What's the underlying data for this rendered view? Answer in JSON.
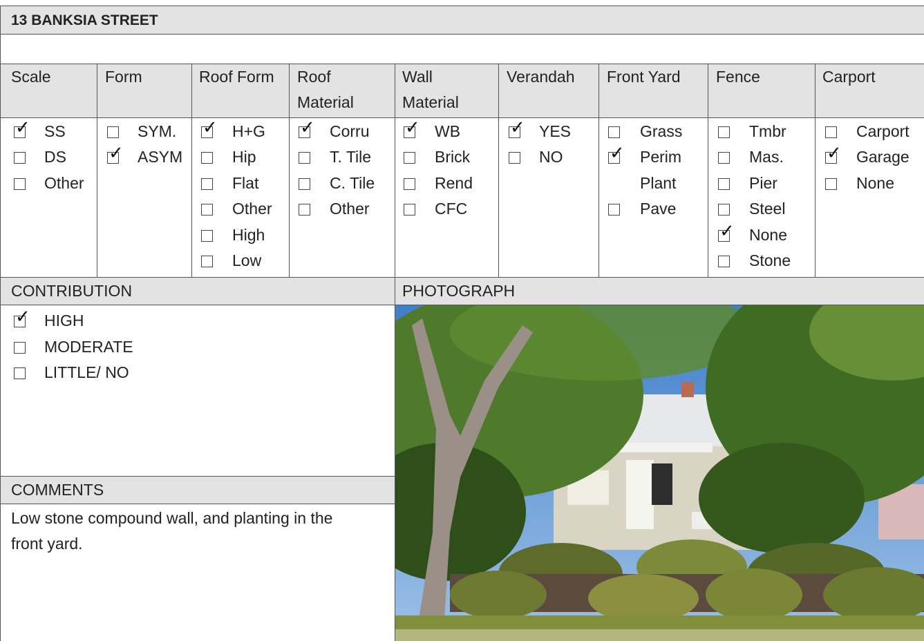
{
  "title": "13 BANKSIA STREET",
  "columns": [
    {
      "header": "Scale",
      "options": [
        {
          "label": "SS",
          "checked": true
        },
        {
          "label": "DS",
          "checked": false
        },
        {
          "label": "Other",
          "checked": false
        }
      ]
    },
    {
      "header": "Form",
      "options": [
        {
          "label": "SYM.",
          "checked": false
        },
        {
          "label": "ASYM",
          "checked": true
        }
      ]
    },
    {
      "header": "Roof Form",
      "options": [
        {
          "label": "H+G",
          "checked": true
        },
        {
          "label": "Hip",
          "checked": false
        },
        {
          "label": "Flat",
          "checked": false
        },
        {
          "label": "Other",
          "checked": false
        },
        {
          "label": "High",
          "checked": false
        },
        {
          "label": "Low",
          "checked": false
        }
      ]
    },
    {
      "header": "Roof\nMaterial",
      "options": [
        {
          "label": "Corru",
          "checked": true
        },
        {
          "label": "T. Tile",
          "checked": false
        },
        {
          "label": "C. Tile",
          "checked": false
        },
        {
          "label": "Other",
          "checked": false
        }
      ]
    },
    {
      "header": "Wall\nMaterial",
      "options": [
        {
          "label": "WB",
          "checked": true
        },
        {
          "label": "Brick",
          "checked": false
        },
        {
          "label": "Rend",
          "checked": false
        },
        {
          "label": "CFC",
          "checked": false
        }
      ]
    },
    {
      "header": "Verandah",
      "options": [
        {
          "label": "YES",
          "checked": true
        },
        {
          "label": "NO",
          "checked": false
        }
      ]
    },
    {
      "header": "Front Yard",
      "options": [
        {
          "label": "Grass",
          "checked": false
        },
        {
          "label": "Perim\nPlant",
          "checked": true
        },
        {
          "label": "Pave",
          "checked": false
        }
      ]
    },
    {
      "header": "Fence",
      "options": [
        {
          "label": "Tmbr",
          "checked": false
        },
        {
          "label": "Mas.",
          "checked": false
        },
        {
          "label": "Pier",
          "checked": false
        },
        {
          "label": "Steel",
          "checked": false
        },
        {
          "label": "None",
          "checked": true
        },
        {
          "label": "Stone",
          "checked": false
        }
      ]
    },
    {
      "header": "Carport",
      "options": [
        {
          "label": "Carport",
          "checked": false
        },
        {
          "label": "Garage",
          "checked": true
        },
        {
          "label": "None",
          "checked": false
        }
      ]
    }
  ],
  "contribution": {
    "header": "CONTRIBUTION",
    "options": [
      {
        "label": "HIGH",
        "checked": true
      },
      {
        "label": "MODERATE",
        "checked": false
      },
      {
        "label": "LITTLE/ NO",
        "checked": false
      }
    ]
  },
  "comments": {
    "header": "COMMENTS",
    "line1": "Low stone compound wall, and planting in the",
    "line2": "front yard."
  },
  "photograph": {
    "header": "PHOTOGRAPH"
  },
  "check_glyph": "✓"
}
